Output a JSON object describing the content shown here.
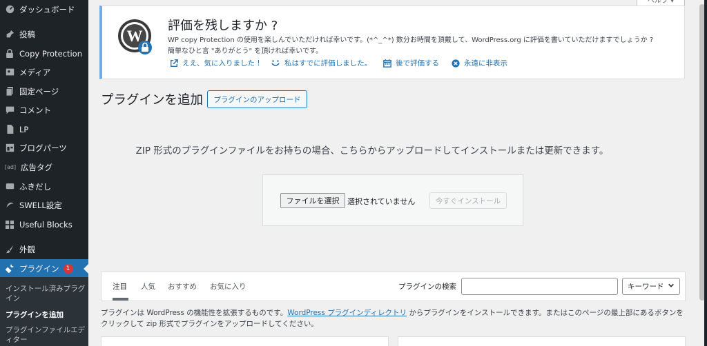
{
  "sidebar": {
    "items": [
      {
        "label": "ダッシュボード",
        "icon": "dashboard-icon"
      },
      {
        "label": "投稿",
        "icon": "pin-icon"
      },
      {
        "label": "Copy Protection",
        "icon": "lock-icon"
      },
      {
        "label": "メディア",
        "icon": "media-icon"
      },
      {
        "label": "固定ページ",
        "icon": "page-icon"
      },
      {
        "label": "コメント",
        "icon": "comment-icon"
      },
      {
        "label": "LP",
        "icon": "document-icon"
      },
      {
        "label": "ブログパーツ",
        "icon": "layout-icon"
      },
      {
        "label": "広告タグ",
        "icon": "ad-icon"
      },
      {
        "label": "ふきだし",
        "icon": "bubble-icon"
      },
      {
        "label": "SWELL設定",
        "icon": "swell-icon"
      },
      {
        "label": "Useful Blocks",
        "icon": "blocks-icon"
      },
      {
        "label": "外観",
        "icon": "brush-icon"
      },
      {
        "label": "プラグイン",
        "icon": "plugin-icon",
        "badge": "1"
      }
    ],
    "submenu": [
      {
        "label": "インストール済みプラグイン"
      },
      {
        "label": "プラグインを追加"
      },
      {
        "label": "プラグインファイルエディター"
      }
    ]
  },
  "help_tab": "ヘルプ ▾",
  "notice": {
    "title": "評価を残しますか ?",
    "line1": "WP copy Protection の使用を楽しんでいただければ幸いです。(*^_^*) 数分お時間を頂戴して、WordPress.org に評価を書いていただけますでしょうか ?",
    "line2": "簡単なひと言 \"ありがとう\" を頂ければ幸いです。",
    "actions": [
      {
        "label": "ええ、気に入りました !",
        "icon": "external-link-icon"
      },
      {
        "label": "私はすでに評価しました。",
        "icon": "smile-icon"
      },
      {
        "label": "後で評価する",
        "icon": "calendar-icon"
      },
      {
        "label": "永遠に非表示",
        "icon": "dismiss-icon"
      }
    ]
  },
  "page": {
    "title": "プラグインを追加",
    "upload_button": "プラグインのアップロード",
    "upload_description": "ZIP 形式のプラグインファイルをお持ちの場合、こちらからアップロードしてインストールまたは更新できます。",
    "file_button": "ファイルを選択",
    "file_status": "選択されていません",
    "install_button": "今すぐインストール"
  },
  "filter": {
    "tabs": [
      "注目",
      "人気",
      "おすすめ",
      "お気に入り"
    ],
    "search_label": "プラグインの検索",
    "search_value": "",
    "select_value": "キーワード"
  },
  "info": {
    "text_before": "プラグインは WordPress の機能性を拡張するものです。",
    "link": "WordPress プラグインディレクトリ",
    "text_after": " からプラグインをインストールできます。またはこのページの最上部にあるボタンをクリックして zip 形式でプラグインをアップロードしてください。"
  },
  "colors": {
    "sidebar": "#1d2327",
    "accent": "#2271b1",
    "notice_border": "#72aee6",
    "badge": "#d63638"
  }
}
